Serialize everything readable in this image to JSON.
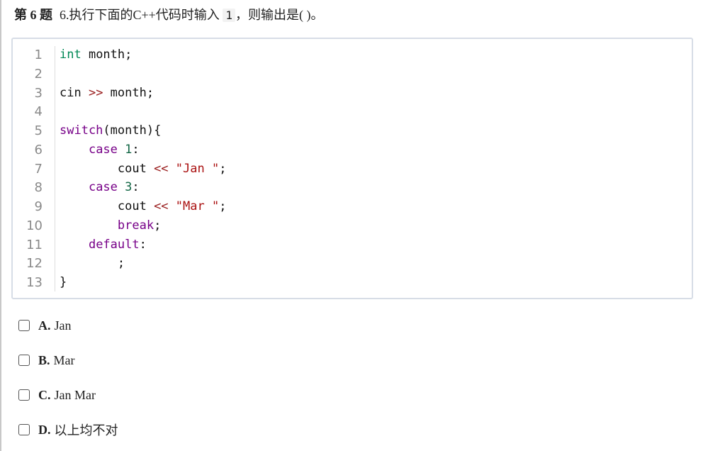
{
  "question": {
    "label": "第 6 题",
    "text_before": "6.执行下面的C++代码时输入",
    "input_value": "1",
    "text_after": "，则输出是(      )。"
  },
  "code": {
    "line_numbers": [
      "1",
      "2",
      "3",
      "4",
      "5",
      "6",
      "7",
      "8",
      "9",
      "10",
      "11",
      "12",
      "13"
    ],
    "lines": [
      [
        {
          "t": "int",
          "k": "type"
        },
        {
          "t": " month;",
          "k": "plain"
        }
      ],
      [],
      [
        {
          "t": "cin ",
          "k": "plain"
        },
        {
          "t": ">>",
          "k": "op"
        },
        {
          "t": " month;",
          "k": "plain"
        }
      ],
      [],
      [
        {
          "t": "switch",
          "k": "keyword"
        },
        {
          "t": "(month){",
          "k": "plain"
        }
      ],
      [
        {
          "t": "    ",
          "k": "plain"
        },
        {
          "t": "case",
          "k": "keyword"
        },
        {
          "t": " ",
          "k": "plain"
        },
        {
          "t": "1",
          "k": "number"
        },
        {
          "t": ":",
          "k": "plain"
        }
      ],
      [
        {
          "t": "        cout ",
          "k": "plain"
        },
        {
          "t": "<<",
          "k": "op"
        },
        {
          "t": " ",
          "k": "plain"
        },
        {
          "t": "\"Jan \"",
          "k": "string"
        },
        {
          "t": ";",
          "k": "plain"
        }
      ],
      [
        {
          "t": "    ",
          "k": "plain"
        },
        {
          "t": "case",
          "k": "keyword"
        },
        {
          "t": " ",
          "k": "plain"
        },
        {
          "t": "3",
          "k": "number"
        },
        {
          "t": ":",
          "k": "plain"
        }
      ],
      [
        {
          "t": "        cout ",
          "k": "plain"
        },
        {
          "t": "<<",
          "k": "op"
        },
        {
          "t": " ",
          "k": "plain"
        },
        {
          "t": "\"Mar \"",
          "k": "string"
        },
        {
          "t": ";",
          "k": "plain"
        }
      ],
      [
        {
          "t": "        ",
          "k": "plain"
        },
        {
          "t": "break",
          "k": "keyword"
        },
        {
          "t": ";",
          "k": "plain"
        }
      ],
      [
        {
          "t": "    ",
          "k": "plain"
        },
        {
          "t": "default",
          "k": "keyword"
        },
        {
          "t": ":",
          "k": "plain"
        }
      ],
      [
        {
          "t": "        ;",
          "k": "plain"
        }
      ],
      [
        {
          "t": "}",
          "k": "plain"
        }
      ]
    ]
  },
  "options": [
    {
      "letter": "A.",
      "text": "Jan"
    },
    {
      "letter": "B.",
      "text": "Mar"
    },
    {
      "letter": "C.",
      "text": "Jan Mar"
    },
    {
      "letter": "D.",
      "text": "以上均不对"
    }
  ]
}
